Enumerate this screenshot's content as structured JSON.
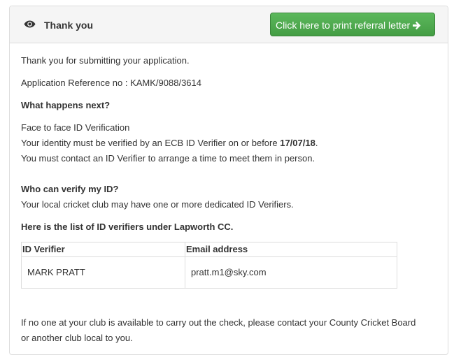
{
  "panel": {
    "title": "Thank you",
    "print_button_label": "Click here to print referral letter",
    "icons": {
      "heading": "eye-icon",
      "button": "arrow-right-icon"
    }
  },
  "content": {
    "thank_you_text": "Thank you for submitting your application.",
    "reference_text": "Application Reference no : KAMK/9088/3614",
    "what_next_heading": "What happens next?",
    "verification_title": "Face to face ID Verification",
    "verification_prefix": "Your identity must be verified by an ECB ID Verifier on or before ",
    "verification_date": "17/07/18",
    "verification_suffix": ".",
    "contact_text": "You must contact an ID Verifier to arrange a time to meet them in person.",
    "who_heading": "Who can verify my ID?",
    "club_text": "Your local cricket club may have one or more dedicated ID Verifiers.",
    "list_heading": "Here is the list of ID verifiers under Lapworth CC.",
    "table": {
      "headers": [
        "ID Verifier",
        "Email address"
      ],
      "rows": [
        [
          "MARK PRATT",
          "pratt.m1@sky.com"
        ]
      ]
    },
    "footer_line1": "If no one at your club is available to carry out the check, please contact your County Cricket Board",
    "footer_line2": "or another club local to you."
  },
  "colors": {
    "button": "#5cb85c",
    "heading_bg": "#f5f5f5",
    "border": "#dddddd",
    "text": "#333333"
  }
}
